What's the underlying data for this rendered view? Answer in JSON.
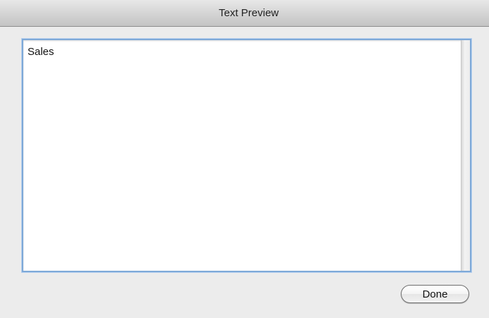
{
  "window": {
    "title": "Text Preview"
  },
  "preview": {
    "text": "Sales"
  },
  "footer": {
    "done_label": "Done"
  },
  "colors": {
    "focus_ring": "#7ea9d8",
    "window_bg": "#ececec"
  }
}
